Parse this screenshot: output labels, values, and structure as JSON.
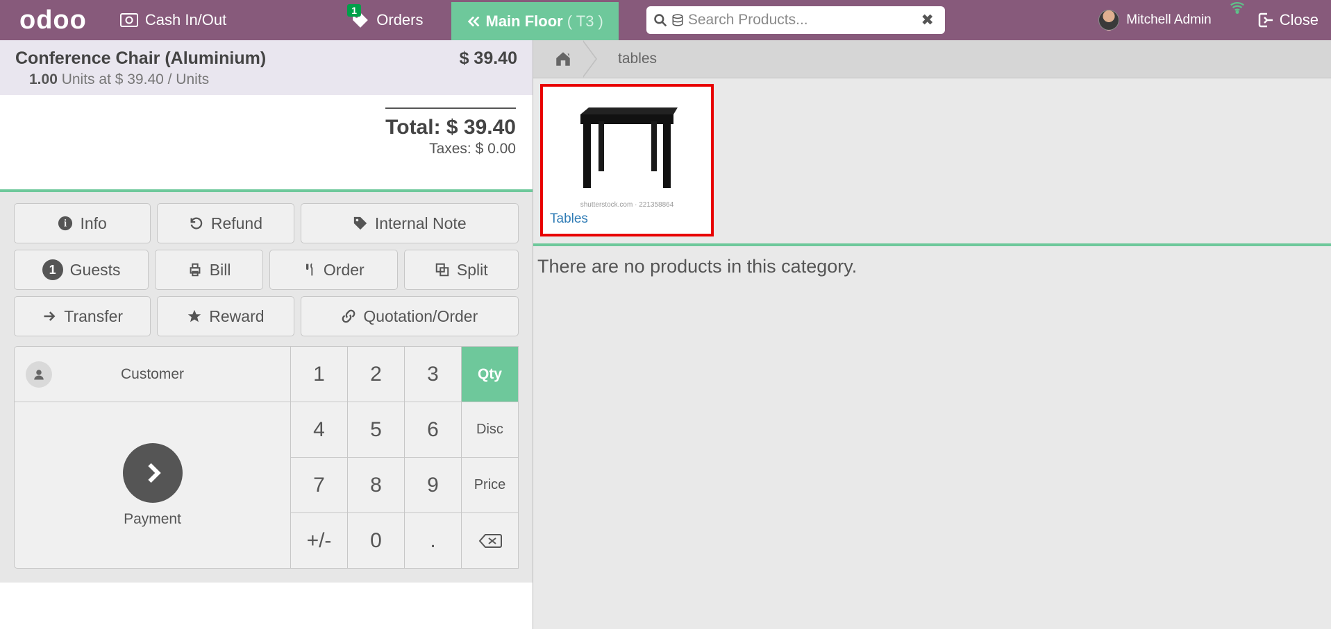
{
  "topbar": {
    "logo": "odoo",
    "cash_label": "Cash In/Out",
    "orders_label": "Orders",
    "orders_badge": "1",
    "floor_label": "Main Floor",
    "floor_sub": "( T3 )",
    "search_placeholder": "Search Products...",
    "user_name": "Mitchell Admin",
    "close_label": "Close"
  },
  "order": {
    "line_name": "Conference Chair (Aluminium)",
    "line_price": "$ 39.40",
    "line_qty_prefix": "1.00",
    "line_qty_suffix": " Units at $ 39.40 / Units",
    "total_label": "Total: $ 39.40",
    "taxes_label": "Taxes: $ 0.00"
  },
  "controls": {
    "info": "Info",
    "refund": "Refund",
    "internal_note": "Internal Note",
    "guests": "Guests",
    "guests_badge": "1",
    "bill": "Bill",
    "order": "Order",
    "split": "Split",
    "transfer": "Transfer",
    "reward": "Reward",
    "quotation": "Quotation/Order",
    "customer": "Customer",
    "payment": "Payment"
  },
  "numpad": {
    "k1": "1",
    "k2": "2",
    "k3": "3",
    "qty": "Qty",
    "k4": "4",
    "k5": "5",
    "k6": "6",
    "disc": "Disc",
    "k7": "7",
    "k8": "8",
    "k9": "9",
    "price": "Price",
    "pm": "+/-",
    "k0": "0",
    "dot": ".",
    "bs": "⌫"
  },
  "breadcrumb": {
    "current": "tables"
  },
  "category": {
    "label": "Tables",
    "caption": "shutterstock.com · 221358864"
  },
  "catalog": {
    "empty_msg": "There are no products in this category."
  }
}
